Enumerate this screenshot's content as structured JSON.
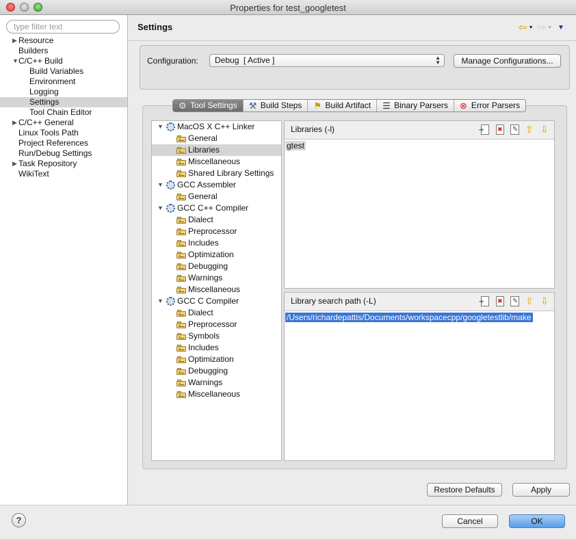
{
  "window": {
    "title": "Properties for test_googletest"
  },
  "sidebar": {
    "filter_placeholder": "type filter text",
    "items": [
      {
        "label": "Resource",
        "expandable": true
      },
      {
        "label": "Builders",
        "expandable": false
      },
      {
        "label": "C/C++ Build",
        "expandable": true,
        "expanded": true
      },
      {
        "label": "Build Variables",
        "child": true
      },
      {
        "label": "Environment",
        "child": true
      },
      {
        "label": "Logging",
        "child": true
      },
      {
        "label": "Settings",
        "child": true,
        "selected": true
      },
      {
        "label": "Tool Chain Editor",
        "child": true
      },
      {
        "label": "C/C++ General",
        "expandable": true
      },
      {
        "label": "Linux Tools Path",
        "expandable": false
      },
      {
        "label": "Project References",
        "expandable": false
      },
      {
        "label": "Run/Debug Settings",
        "expandable": false
      },
      {
        "label": "Task Repository",
        "expandable": true
      },
      {
        "label": "WikiText",
        "expandable": false
      }
    ]
  },
  "header": {
    "title": "Settings",
    "back_icon": "back-arrow-icon",
    "forward_icon": "forward-arrow-icon",
    "menu_icon": "view-menu-icon"
  },
  "configuration": {
    "label": "Configuration:",
    "selected": "Debug  [ Active ]",
    "manage_button": "Manage Configurations..."
  },
  "tabs": [
    {
      "label": "Tool Settings",
      "active": true,
      "icon": "tool-settings-icon"
    },
    {
      "label": "Build Steps",
      "active": false,
      "icon": "build-steps-icon"
    },
    {
      "label": "Build Artifact",
      "active": false,
      "icon": "build-artifact-icon"
    },
    {
      "label": "Binary Parsers",
      "active": false,
      "icon": "binary-parsers-icon"
    },
    {
      "label": "Error Parsers",
      "active": false,
      "icon": "error-parsers-icon"
    }
  ],
  "tree": [
    {
      "label": "MacOS X C++ Linker",
      "level": 0,
      "kind": "tool"
    },
    {
      "label": "General",
      "level": 1,
      "kind": "option"
    },
    {
      "label": "Libraries",
      "level": 1,
      "kind": "option",
      "selected": true
    },
    {
      "label": "Miscellaneous",
      "level": 1,
      "kind": "option"
    },
    {
      "label": "Shared Library Settings",
      "level": 1,
      "kind": "option"
    },
    {
      "label": "GCC Assembler",
      "level": 0,
      "kind": "tool"
    },
    {
      "label": "General",
      "level": 1,
      "kind": "option"
    },
    {
      "label": "GCC C++ Compiler",
      "level": 0,
      "kind": "tool"
    },
    {
      "label": "Dialect",
      "level": 1,
      "kind": "option"
    },
    {
      "label": "Preprocessor",
      "level": 1,
      "kind": "option"
    },
    {
      "label": "Includes",
      "level": 1,
      "kind": "option"
    },
    {
      "label": "Optimization",
      "level": 1,
      "kind": "option"
    },
    {
      "label": "Debugging",
      "level": 1,
      "kind": "option"
    },
    {
      "label": "Warnings",
      "level": 1,
      "kind": "option"
    },
    {
      "label": "Miscellaneous",
      "level": 1,
      "kind": "option"
    },
    {
      "label": "GCC C Compiler",
      "level": 0,
      "kind": "tool"
    },
    {
      "label": "Dialect",
      "level": 1,
      "kind": "option"
    },
    {
      "label": "Preprocessor",
      "level": 1,
      "kind": "option"
    },
    {
      "label": "Symbols",
      "level": 1,
      "kind": "option"
    },
    {
      "label": "Includes",
      "level": 1,
      "kind": "option"
    },
    {
      "label": "Optimization",
      "level": 1,
      "kind": "option"
    },
    {
      "label": "Debugging",
      "level": 1,
      "kind": "option"
    },
    {
      "label": "Warnings",
      "level": 1,
      "kind": "option"
    },
    {
      "label": "Miscellaneous",
      "level": 1,
      "kind": "option"
    }
  ],
  "libraries": {
    "title": "Libraries (-l)",
    "entries": [
      "gtest"
    ]
  },
  "library_search_path": {
    "title": "Library search path (-L)",
    "entries": [
      "/Users/richardepattis/Documents/workspacecpp/googletestlib/make"
    ]
  },
  "list_tools": [
    "add-icon",
    "delete-icon",
    "edit-icon",
    "move-up-icon",
    "move-down-icon"
  ],
  "buttons": {
    "restore_defaults": "Restore Defaults",
    "apply": "Apply",
    "cancel": "Cancel",
    "ok": "OK",
    "help": "?"
  }
}
